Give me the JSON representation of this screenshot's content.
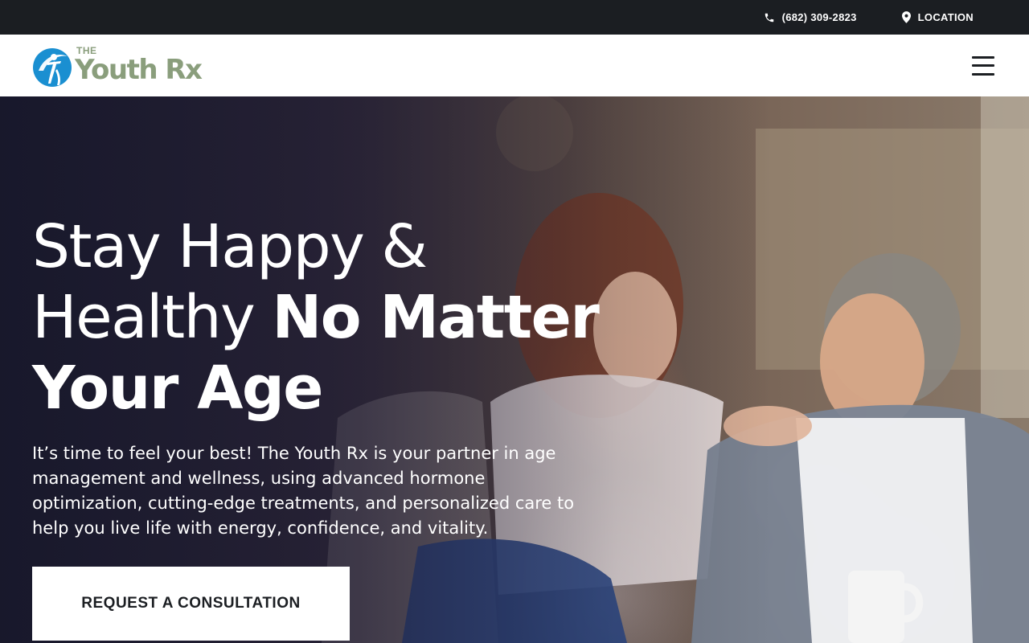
{
  "topbar": {
    "phone": "(682) 309-2823",
    "phone_icon": "phone-icon",
    "location": "LOCATION",
    "location_icon": "map-pin-icon"
  },
  "header": {
    "logo_the": "THE",
    "logo_name": "Youth Rx",
    "logo_icon": "figure-swoosh-logo",
    "menu_icon": "hamburger-menu-icon"
  },
  "hero": {
    "title_line1": "Stay Happy &",
    "title_line2_light": "Healthy ",
    "title_line2_strong": "No Matter",
    "title_line3_strong": "Your Age",
    "body": "It’s time to feel your best! The Youth Rx is your partner in age management and wellness, using advanced hormone optimization, cutting-edge treatments, and personalized care to help you live life with energy, confidence, and vitality.",
    "cta_label": "REQUEST A CONSULTATION"
  },
  "colors": {
    "topbar_bg": "#1b1e22",
    "brand_blue": "#1a8fd1",
    "brand_sage": "#8a9e7c",
    "header_bg": "#ffffff",
    "cta_bg": "#ffffff"
  }
}
